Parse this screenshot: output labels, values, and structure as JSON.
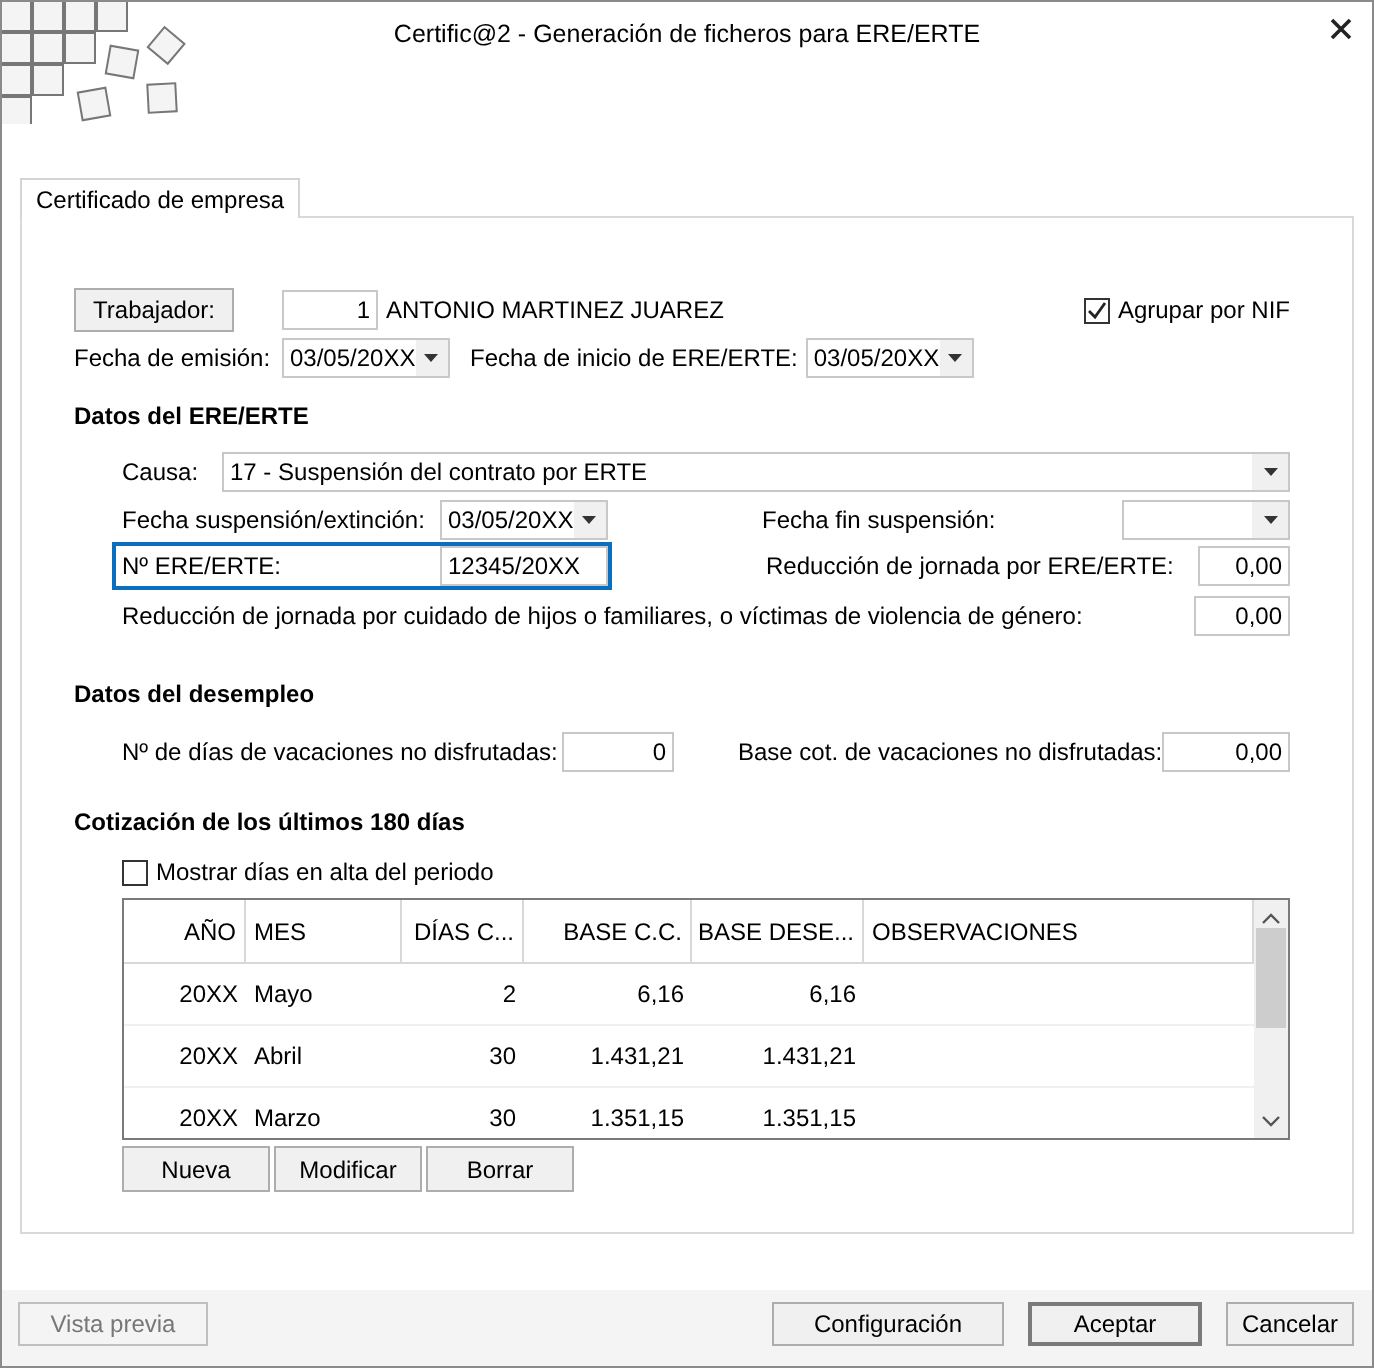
{
  "window": {
    "title": "Certific@2 - Generación de ficheros para ERE/ERTE"
  },
  "tabs": [
    {
      "label": "Certificado de empresa",
      "selected": true
    }
  ],
  "worker": {
    "button": "Trabajador:",
    "number": "1",
    "name": "ANTONIO MARTINEZ JUAREZ"
  },
  "group_by_nif": {
    "label": "Agrupar por NIF",
    "checked": true
  },
  "dates": [
    {
      "label": "Fecha de emisión:",
      "value": "03/05/20XX"
    },
    {
      "label": "Fecha de inicio de ERE/ERTE:",
      "value": "03/05/20XX"
    }
  ],
  "ere_section": {
    "heading": "Datos del ERE/ERTE",
    "cause": {
      "label": "Causa:",
      "value": "17 - Suspensión del contrato por ERTE"
    },
    "suspension_date": {
      "label": "Fecha suspensión/extinción:",
      "value": "03/05/20XX"
    },
    "suspension_end": {
      "label": "Fecha fin suspensión:"
    },
    "ere_number": {
      "label": "Nº ERE/ERTE:",
      "value": "12345/20XX",
      "focused": true
    },
    "reduction_ere": {
      "label": "Reducción de jornada por ERE/ERTE:",
      "value": "0,00"
    },
    "reduction_care": {
      "label": "Reducción de jornada por cuidado de hijos o familiares, o víctimas de violencia de género:",
      "value": "0,00"
    }
  },
  "unemployment": {
    "heading": "Datos del desempleo",
    "vacation_days": {
      "label": "Nº de días de vacaciones no disfrutadas:",
      "value": "0"
    },
    "vacation_base": {
      "label": "Base cot. de vacaciones no disfrutadas:",
      "value": "0,00"
    }
  },
  "contributions": {
    "heading": "Cotización de los últimos 180 días",
    "show_days": {
      "label": "Mostrar días en alta del periodo",
      "checked": false
    },
    "table": {
      "columns": [
        "AÑO",
        "MES",
        "DÍAS C...",
        "BASE C.C.",
        "BASE DESE...",
        "OBSERVACIONES"
      ],
      "rows": [
        [
          "20XX",
          "Mayo",
          "2",
          "6,16",
          "6,16"
        ],
        [
          "20XX",
          "Abril",
          "30",
          "1.431,21",
          "1.431,21"
        ],
        [
          "20XX",
          "Marzo",
          "30",
          "1.351,15",
          "1.351,15"
        ]
      ]
    },
    "buttons": [
      "Nueva",
      "Modificar",
      "Borrar"
    ]
  },
  "footer_buttons": [
    {
      "label": "Vista previa",
      "disabled": true,
      "default": false
    },
    {
      "label": "Configuración",
      "disabled": false,
      "default": false
    },
    {
      "label": "Aceptar",
      "disabled": false,
      "default": true
    },
    {
      "label": "Cancelar",
      "disabled": false,
      "default": false
    }
  ]
}
